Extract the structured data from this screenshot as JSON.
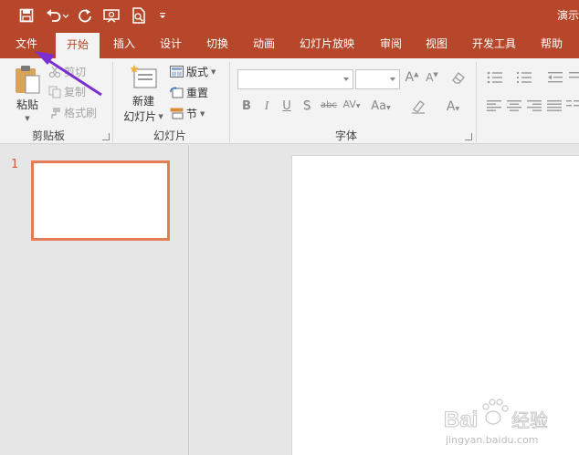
{
  "colors": {
    "ribbon_accent": "#b7472a",
    "ribbon_bg": "#f3f3f3",
    "thumbnail_border": "#e67b58",
    "annotation_arrow": "#7b2fd0"
  },
  "title_bar": {
    "document_title": "演示",
    "quick_access": [
      {
        "icon": "save-icon"
      },
      {
        "icon": "undo-icon"
      },
      {
        "icon": "redo-icon"
      },
      {
        "icon": "slideshow-from-start-icon"
      },
      {
        "icon": "print-preview-icon"
      },
      {
        "icon": "customize-toolbar-icon"
      }
    ]
  },
  "tabs": [
    {
      "label": "文件"
    },
    {
      "label": "开始",
      "active": true
    },
    {
      "label": "插入"
    },
    {
      "label": "设计"
    },
    {
      "label": "切换"
    },
    {
      "label": "动画"
    },
    {
      "label": "幻灯片放映"
    },
    {
      "label": "审阅"
    },
    {
      "label": "视图"
    },
    {
      "label": "开发工具"
    },
    {
      "label": "帮助"
    }
  ],
  "ribbon": {
    "clipboard": {
      "group_label": "剪贴板",
      "paste": "粘贴",
      "cut": "剪切",
      "copy": "复制",
      "format_painter": "格式刷"
    },
    "slides": {
      "group_label": "幻灯片",
      "new_slide_line1": "新建",
      "new_slide_line2": "幻灯片",
      "layout": "版式",
      "reset": "重置",
      "section": "节"
    },
    "font": {
      "group_label": "字体",
      "font_name": "",
      "font_size": "",
      "bold": "B",
      "italic": "I",
      "underline": "U",
      "shadow": "S",
      "strikethrough": "abc",
      "char_spacing": "AV",
      "change_case": "Aa",
      "font_color": "A",
      "grow_font": "A",
      "shrink_font": "A"
    }
  },
  "slides_pane": {
    "slides": [
      {
        "number": "1",
        "selected": true
      }
    ]
  },
  "watermark": {
    "brand": "Bai 经验",
    "url": "jingyan.baidu.com"
  }
}
